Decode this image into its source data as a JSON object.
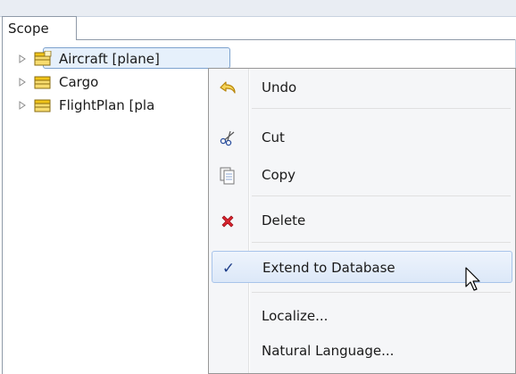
{
  "tab": {
    "label": "Scope"
  },
  "tree": {
    "items": [
      {
        "label": "Aircraft [plane]",
        "selected": true,
        "icon": "class-icon-highlighted"
      },
      {
        "label": "Cargo",
        "selected": false,
        "icon": "class-icon"
      },
      {
        "label": "FlightPlan [pla",
        "selected": false,
        "icon": "class-icon"
      }
    ]
  },
  "menu": {
    "items": [
      {
        "label": "Undo",
        "icon": "undo-icon"
      },
      {
        "label": "Cut",
        "icon": "scissors-icon"
      },
      {
        "label": "Copy",
        "icon": "copy-icon"
      },
      {
        "label": "Delete",
        "icon": "delete-x-icon"
      },
      {
        "label": "Extend to Database",
        "icon": "checkmark-icon",
        "checked": true,
        "hovered": true
      },
      {
        "label": "Localize...",
        "icon": ""
      },
      {
        "label": "Natural Language...",
        "icon": ""
      }
    ]
  },
  "colors": {
    "selection_fill": "#e6f0fb",
    "selection_border": "#7da2ce",
    "menu_background": "#f5f6f8",
    "delete_red": "#d9232e",
    "undo_yellow": "#f0c419",
    "check_blue": "#1f3f8a"
  }
}
